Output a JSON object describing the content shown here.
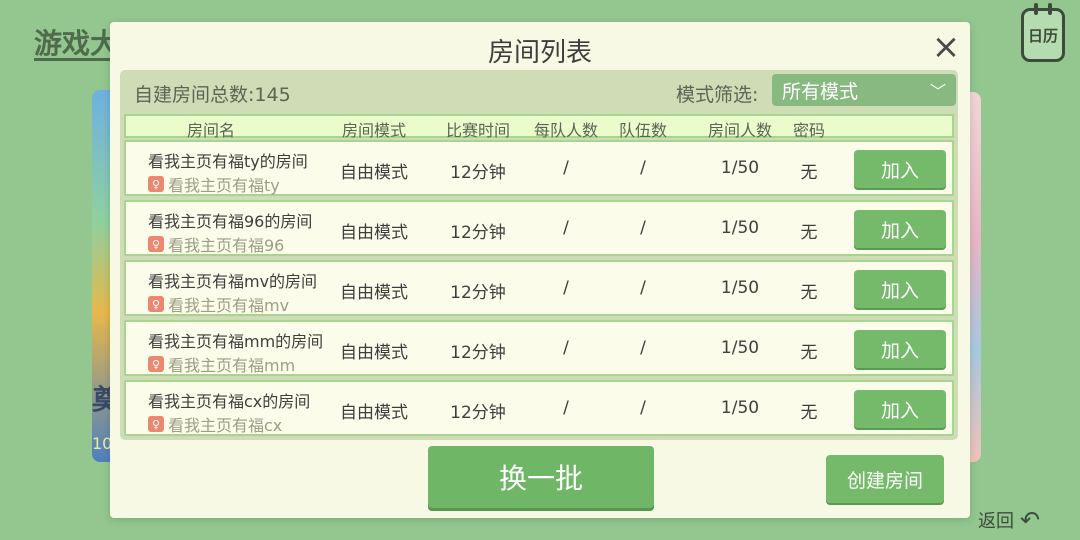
{
  "background": {
    "title": "游戏大",
    "left_card_text": "奠",
    "left_card_number": "10",
    "calendar_label": "日历",
    "back_label": "返回"
  },
  "dialog": {
    "title": "房间列表",
    "total_label": "自建房间总数:145",
    "filter_label": "模式筛选:",
    "filter_value": "所有模式",
    "columns": [
      "房间名",
      "房间模式",
      "比赛时间",
      "每队人数",
      "队伍数",
      "房间人数",
      "密码"
    ],
    "rooms": [
      {
        "name": "看我主页有福ty的房间",
        "host": "看我主页有福ty",
        "mode": "自由模式",
        "time": "12分钟",
        "per_team": "/",
        "teams": "/",
        "players": "1/50",
        "password": "无",
        "join": "加入"
      },
      {
        "name": "看我主页有福96的房间",
        "host": "看我主页有福96",
        "mode": "自由模式",
        "time": "12分钟",
        "per_team": "/",
        "teams": "/",
        "players": "1/50",
        "password": "无",
        "join": "加入"
      },
      {
        "name": "看我主页有福mv的房间",
        "host": "看我主页有福mv",
        "mode": "自由模式",
        "time": "12分钟",
        "per_team": "/",
        "teams": "/",
        "players": "1/50",
        "password": "无",
        "join": "加入"
      },
      {
        "name": "看我主页有福mm的房间",
        "host": "看我主页有福mm",
        "mode": "自由模式",
        "time": "12分钟",
        "per_team": "/",
        "teams": "/",
        "players": "1/50",
        "password": "无",
        "join": "加入"
      },
      {
        "name": "看我主页有福cx的房间",
        "host": "看我主页有福cx",
        "mode": "自由模式",
        "time": "12分钟",
        "per_team": "/",
        "teams": "/",
        "players": "1/50",
        "password": "无",
        "join": "加入"
      }
    ],
    "refresh_label": "换一批",
    "create_label": "创建房间"
  }
}
